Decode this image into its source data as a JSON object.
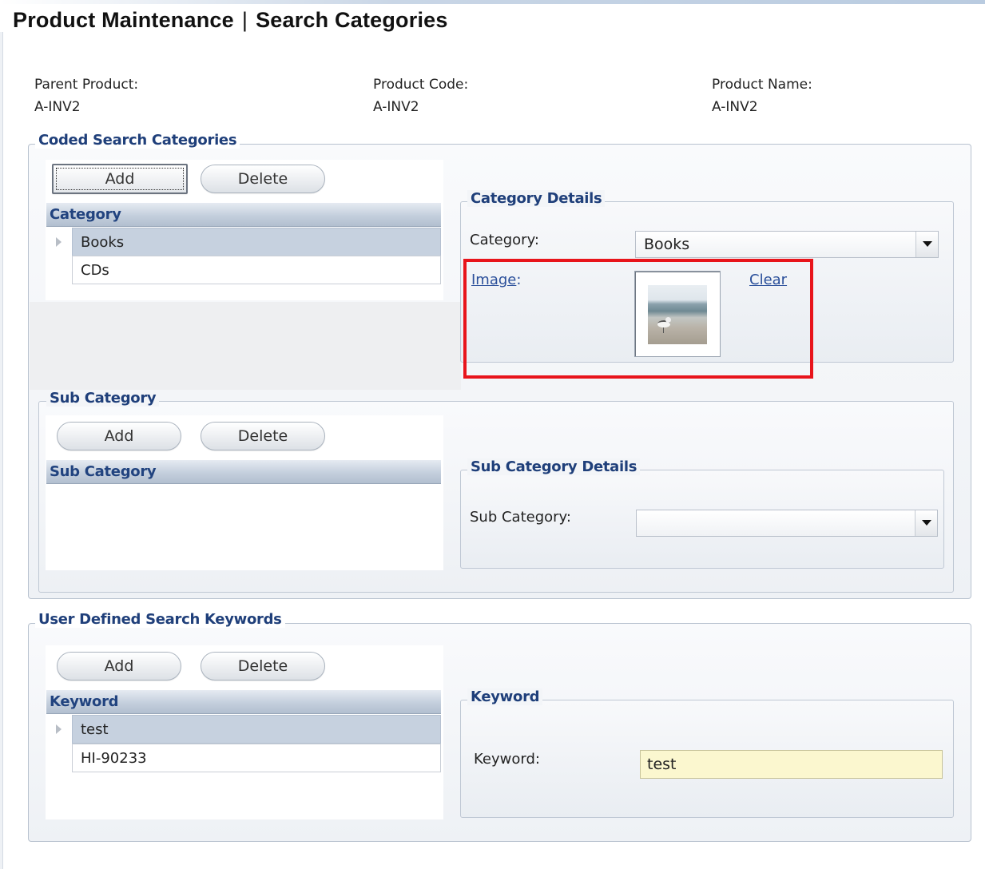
{
  "header": {
    "title": "Product Maintenance",
    "separator": "|",
    "subtitle": "Search Categories"
  },
  "product_info": {
    "parent_product_label": "Parent Product:",
    "parent_product_value": "A-INV2",
    "product_code_label": "Product Code:",
    "product_code_value": "A-INV2",
    "product_name_label": "Product Name:",
    "product_name_value": "A-INV2"
  },
  "coded_search": {
    "title": "Coded Search Categories",
    "add_label": "Add",
    "delete_label": "Delete",
    "grid_header": "Category",
    "rows": [
      "Books",
      "CDs"
    ],
    "details": {
      "title": "Category Details",
      "category_label": "Category:",
      "category_value": "Books",
      "image_link": "Image",
      "image_colon": ":",
      "clear_link": "Clear"
    }
  },
  "sub_category": {
    "title": "Sub Category",
    "add_label": "Add",
    "delete_label": "Delete",
    "grid_header": "Sub Category",
    "details": {
      "title": "Sub Category Details",
      "sub_category_label": "Sub Category:",
      "sub_category_value": ""
    }
  },
  "keywords": {
    "title": "User Defined Search Keywords",
    "add_label": "Add",
    "delete_label": "Delete",
    "grid_header": "Keyword",
    "rows": [
      "test",
      "HI-90233"
    ],
    "details": {
      "title": "Keyword",
      "keyword_label": "Keyword:",
      "keyword_value": "test"
    }
  },
  "colors": {
    "group_title": "#1f3f7a",
    "link": "#2a4f9a",
    "highlight": "#e8141b",
    "input_bg": "#fbf7cf",
    "selected_row": "#c6d1df"
  }
}
